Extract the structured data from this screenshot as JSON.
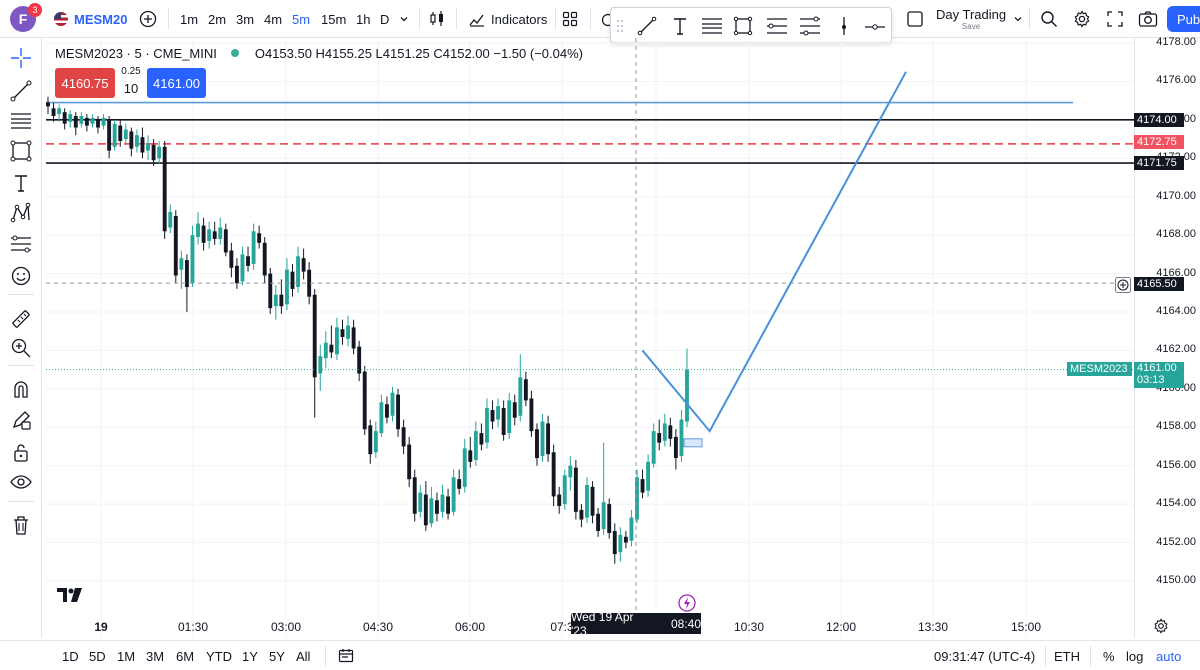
{
  "header": {
    "avatar_letter": "F",
    "notification_count": "3",
    "symbol": "MESM20",
    "timeframes": [
      "1m",
      "2m",
      "3m",
      "4m",
      "5m",
      "15m",
      "1h",
      "D"
    ],
    "active_timeframe": "5m",
    "indicators_label": "Indicators",
    "layout_name": "Day Trading",
    "layout_status": "Save",
    "publish_label": "Pub"
  },
  "legend": {
    "symbol_line": "MESM2023 · 5 · CME_MINI",
    "ohlc": "O4153.50 H4155.25 L4151.25 C4152.00 −1.50 (−0.04%)"
  },
  "trade": {
    "sell_price": "4160.75",
    "buy_price": "4161.00",
    "spread": "0.25",
    "quantity": "10"
  },
  "price_axis": {
    "labels": [
      "4178.00",
      "4176.00",
      "4174.00",
      "4172.00",
      "4170.00",
      "4168.00",
      "4166.00",
      "4164.00",
      "4162.00",
      "4160.00",
      "4158.00",
      "4156.00",
      "4154.00",
      "4152.00",
      "4150.00"
    ],
    "tags": {
      "line_upper": "4174.00",
      "line_red": "4172.75",
      "line_lower": "4171.75",
      "crosshair": "4165.50",
      "symbol_name": "MESM2023",
      "last_price": "4161.00",
      "countdown": "03:13"
    }
  },
  "time_axis": {
    "labels": [
      "19",
      "01:30",
      "03:00",
      "04:30",
      "06:00",
      "07:3",
      "10:30",
      "12:00",
      "13:30",
      "15:00"
    ],
    "crosshair_date": "Wed 19 Apr '23",
    "crosshair_time": "08:40"
  },
  "bottom": {
    "ranges": [
      "1D",
      "5D",
      "1M",
      "3M",
      "6M",
      "YTD",
      "1Y",
      "5Y",
      "All"
    ],
    "clock": "09:31:47 (UTC-4)",
    "session": "ETH",
    "percent": "%",
    "log": "log",
    "auto": "auto"
  },
  "colors": {
    "up": "#26a69a",
    "down": "#131722",
    "accent": "#2962ff",
    "sell": "#e04444",
    "forecast_line": "#4a90d9"
  },
  "chart_data": {
    "type": "candlestick",
    "symbol": "MESM2023",
    "interval": "5",
    "ylim": [
      4149,
      4179
    ],
    "candles": [
      [
        4174.9,
        4174.7,
        4175.2,
        4174.3
      ],
      [
        4174.6,
        4174.2,
        4174.9,
        4173.9
      ],
      [
        4174.3,
        4174.6,
        4174.8,
        4173.9
      ],
      [
        4174.4,
        4173.8,
        4174.6,
        4173.5
      ],
      [
        4173.9,
        4174.3,
        4174.5,
        4173.6
      ],
      [
        4174.2,
        4173.6,
        4174.4,
        4173.2
      ],
      [
        4173.8,
        4174.2,
        4174.4,
        4173.6
      ],
      [
        4174.1,
        4173.7,
        4174.3,
        4173.4
      ],
      [
        4173.8,
        4174.1,
        4174.3,
        4173.6
      ],
      [
        4174.0,
        4173.6,
        4174.2,
        4173.3
      ],
      [
        4173.7,
        4174.1,
        4174.3,
        4173.5
      ],
      [
        4174.0,
        4172.4,
        4174.2,
        4172.0
      ],
      [
        4172.6,
        4173.8,
        4174.0,
        4172.4
      ],
      [
        4173.7,
        4172.9,
        4174.0,
        4172.6
      ],
      [
        4173.0,
        4173.5,
        4173.8,
        4172.7
      ],
      [
        4173.4,
        4172.5,
        4173.6,
        4172.1
      ],
      [
        4172.6,
        4173.2,
        4173.5,
        4172.3
      ],
      [
        4173.1,
        4172.3,
        4173.6,
        4172.0
      ],
      [
        4172.4,
        4172.8,
        4173.2,
        4171.9
      ],
      [
        4172.7,
        4171.9,
        4173.0,
        4171.6
      ],
      [
        4172.0,
        4172.6,
        4172.9,
        4171.7
      ],
      [
        4172.6,
        4168.2,
        4172.9,
        4167.8
      ],
      [
        4168.4,
        4169.2,
        4169.6,
        4168.1
      ],
      [
        4169.0,
        4165.9,
        4169.3,
        4165.5
      ],
      [
        4166.2,
        4166.8,
        4167.2,
        4165.2
      ],
      [
        4166.7,
        4165.3,
        4167.0,
        4164.0
      ],
      [
        4165.5,
        4168.0,
        4168.5,
        4165.3
      ],
      [
        4167.9,
        4168.6,
        4169.2,
        4167.5
      ],
      [
        4168.5,
        4167.6,
        4168.9,
        4167.2
      ],
      [
        4167.7,
        4168.3,
        4168.7,
        4167.3
      ],
      [
        4168.2,
        4167.8,
        4168.7,
        4167.5
      ],
      [
        4167.8,
        4168.4,
        4168.9,
        4167.5
      ],
      [
        4168.3,
        4167.1,
        4168.6,
        4166.9
      ],
      [
        4167.2,
        4166.3,
        4167.6,
        4165.8
      ],
      [
        4166.4,
        4165.5,
        4166.8,
        4165.2
      ],
      [
        4165.6,
        4167.0,
        4167.4,
        4165.4
      ],
      [
        4166.9,
        4166.4,
        4167.4,
        4166.1
      ],
      [
        4166.5,
        4168.2,
        4168.6,
        4166.2
      ],
      [
        4168.1,
        4167.6,
        4168.5,
        4167.3
      ],
      [
        4167.6,
        4165.9,
        4167.9,
        4165.5
      ],
      [
        4166.0,
        4164.2,
        4166.3,
        4163.9
      ],
      [
        4164.3,
        4164.9,
        4165.4,
        4163.6
      ],
      [
        4164.9,
        4164.3,
        4165.7,
        4163.9
      ],
      [
        4164.4,
        4166.2,
        4166.8,
        4164.1
      ],
      [
        4166.1,
        4165.2,
        4166.5,
        4164.8
      ],
      [
        4165.3,
        4166.9,
        4167.4,
        4165.0
      ],
      [
        4166.8,
        4166.1,
        4167.3,
        4165.7
      ],
      [
        4166.2,
        4164.8,
        4166.6,
        4164.4
      ],
      [
        4164.9,
        4160.6,
        4165.2,
        4158.5
      ],
      [
        4160.8,
        4161.7,
        4162.3,
        4159.9
      ],
      [
        4161.6,
        4162.4,
        4163.0,
        4161.1
      ],
      [
        4162.3,
        4161.9,
        4163.3,
        4161.6
      ],
      [
        4161.8,
        4163.2,
        4163.7,
        4161.5
      ],
      [
        4163.1,
        4162.7,
        4163.6,
        4162.3
      ],
      [
        4162.6,
        4163.3,
        4163.8,
        4162.2
      ],
      [
        4163.2,
        4162.1,
        4163.6,
        4161.8
      ],
      [
        4162.2,
        4160.8,
        4162.5,
        4160.4
      ],
      [
        4160.9,
        4157.9,
        4161.2,
        4157.6
      ],
      [
        4158.1,
        4156.6,
        4158.4,
        4156.1
      ],
      [
        4156.7,
        4157.8,
        4158.3,
        4156.4
      ],
      [
        4157.7,
        4159.3,
        4159.7,
        4157.5
      ],
      [
        4159.2,
        4158.5,
        4159.6,
        4158.2
      ],
      [
        4158.6,
        4159.8,
        4160.1,
        4158.3
      ],
      [
        4159.7,
        4157.9,
        4160.0,
        4157.5
      ],
      [
        4158.0,
        4157.0,
        4158.4,
        4156.6
      ],
      [
        4157.1,
        4155.3,
        4157.5,
        4154.9
      ],
      [
        4155.4,
        4153.5,
        4155.8,
        4153.1
      ],
      [
        4153.6,
        4154.6,
        4155.0,
        4153.3
      ],
      [
        4154.5,
        4152.9,
        4155.2,
        4152.6
      ],
      [
        4153.0,
        4154.3,
        4154.9,
        4152.8
      ],
      [
        4154.2,
        4153.5,
        4154.6,
        4153.1
      ],
      [
        4153.6,
        4154.5,
        4155.0,
        4153.3
      ],
      [
        4154.4,
        4153.5,
        4154.8,
        4153.2
      ],
      [
        4153.6,
        4155.4,
        4155.8,
        4153.4
      ],
      [
        4155.3,
        4154.8,
        4155.8,
        4154.5
      ],
      [
        4154.9,
        4156.9,
        4157.4,
        4154.6
      ],
      [
        4156.8,
        4156.2,
        4157.5,
        4155.9
      ],
      [
        4156.3,
        4157.8,
        4158.3,
        4156.0
      ],
      [
        4157.7,
        4157.1,
        4158.2,
        4156.8
      ],
      [
        4157.2,
        4159.0,
        4159.5,
        4156.9
      ],
      [
        4158.9,
        4158.3,
        4159.4,
        4157.9
      ],
      [
        4158.4,
        4159.1,
        4159.5,
        4158.0
      ],
      [
        4159.0,
        4157.6,
        4159.4,
        4157.3
      ],
      [
        4157.7,
        4159.4,
        4159.8,
        4157.4
      ],
      [
        4159.3,
        4158.5,
        4159.7,
        4158.1
      ],
      [
        4158.6,
        4160.6,
        4161.8,
        4158.3
      ],
      [
        4160.5,
        4159.4,
        4160.9,
        4159.1
      ],
      [
        4159.5,
        4157.8,
        4159.9,
        4157.5
      ],
      [
        4157.9,
        4156.4,
        4158.2,
        4156.0
      ],
      [
        4156.5,
        4158.3,
        4158.7,
        4156.2
      ],
      [
        4158.2,
        4156.6,
        4158.6,
        4156.2
      ],
      [
        4156.7,
        4154.4,
        4157.1,
        4153.9
      ],
      [
        4154.5,
        4153.9,
        4154.9,
        4153.5
      ],
      [
        4154.0,
        4155.5,
        4155.8,
        4153.7
      ],
      [
        4155.4,
        4156.0,
        4156.5,
        4154.7
      ],
      [
        4155.9,
        4153.6,
        4156.3,
        4153.2
      ],
      [
        4153.7,
        4153.2,
        4154.0,
        4152.8
      ],
      [
        4153.3,
        4155.0,
        4155.4,
        4153.0
      ],
      [
        4154.9,
        4153.4,
        4155.2,
        4153.0
      ],
      [
        4153.5,
        4152.6,
        4153.8,
        4152.3
      ],
      [
        4152.7,
        4154.1,
        4157.2,
        4152.4
      ],
      [
        4154.0,
        4152.5,
        4154.3,
        4152.2
      ],
      [
        4152.6,
        4151.4,
        4153.0,
        4150.9
      ],
      [
        4151.5,
        4152.4,
        4152.8,
        4151.0
      ],
      [
        4152.3,
        4152.0,
        4152.6,
        4151.7
      ],
      [
        4152.1,
        4153.3,
        4153.7,
        4151.8
      ],
      [
        4153.2,
        4155.4,
        4155.8,
        4153.0
      ],
      [
        4155.3,
        4154.6,
        4155.8,
        4154.3
      ],
      [
        4154.7,
        4156.2,
        4156.6,
        4154.4
      ],
      [
        4156.1,
        4157.8,
        4158.2,
        4155.9
      ],
      [
        4157.7,
        4157.2,
        4158.4,
        4156.8
      ],
      [
        4157.3,
        4158.2,
        4158.7,
        4157.0
      ],
      [
        4158.1,
        4157.4,
        4158.5,
        4157.0
      ],
      [
        4157.5,
        4156.4,
        4157.9,
        4155.8
      ],
      [
        4156.5,
        4158.4,
        4158.9,
        4156.2
      ],
      [
        4158.3,
        4161.0,
        4162.1,
        4158.0
      ]
    ],
    "horizontal_levels": [
      4174.0,
      4172.75,
      4171.75
    ],
    "forecast_path": [
      [
        "08:45",
        4162.0
      ],
      [
        "09:50",
        4157.8
      ],
      [
        "13:00",
        4176.5
      ]
    ]
  }
}
